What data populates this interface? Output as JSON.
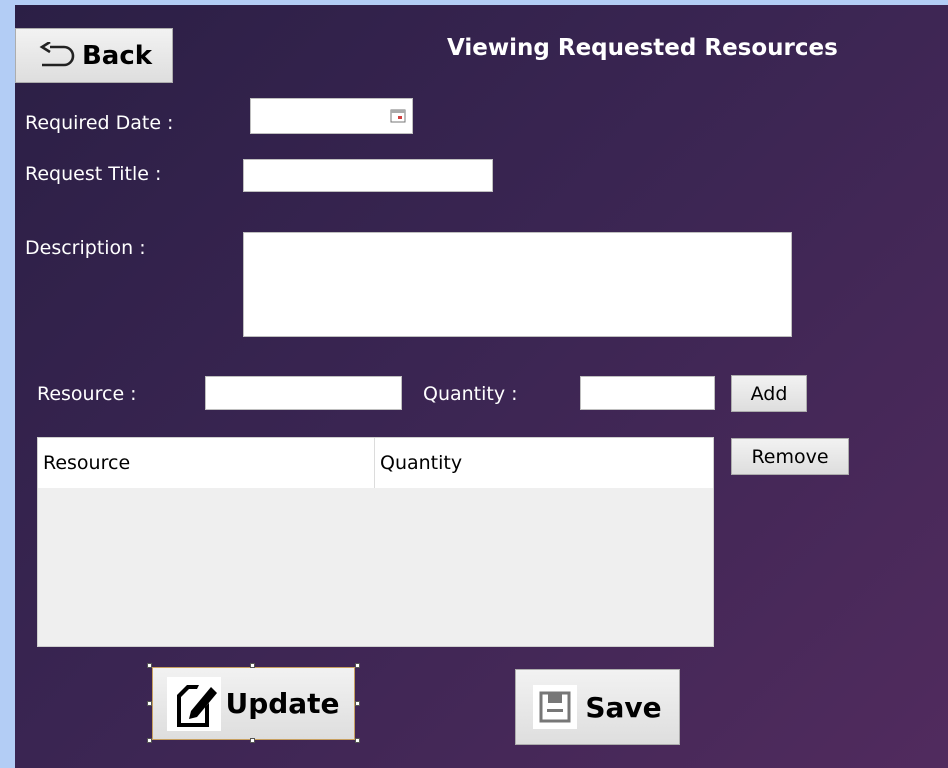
{
  "window": {
    "title": "Viewing Requested Resources"
  },
  "toolbar": {
    "back_label": "Back"
  },
  "form": {
    "required_date_label": "Required Date :",
    "required_date_value": "",
    "request_title_label": "Request Title :",
    "request_title_value": "",
    "description_label": "Description :",
    "description_value": "",
    "resource_label": "Resource :",
    "resource_value": "",
    "quantity_label": "Quantity :",
    "quantity_value": "",
    "add_label": "Add",
    "remove_label": "Remove"
  },
  "grid": {
    "columns": [
      "Resource",
      "Quantity"
    ],
    "rows": []
  },
  "actions": {
    "update_label": "Update",
    "save_label": "Save"
  },
  "icons": {
    "back": "back-arrow-icon",
    "calendar": "calendar-icon",
    "update": "edit-document-icon",
    "save": "floppy-disk-icon"
  }
}
